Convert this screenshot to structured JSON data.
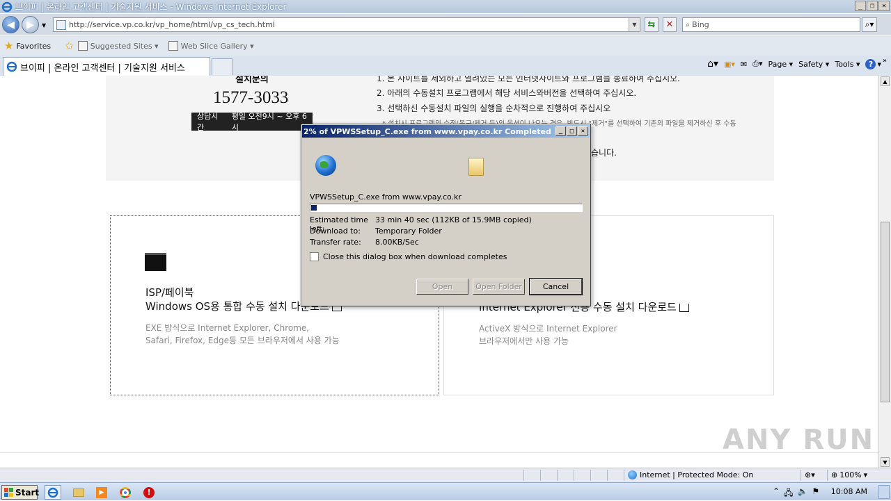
{
  "window": {
    "title": "브이피 | 온라인 고객센터 | 기술지원 서비스 - Windows Internet Explorer",
    "buttons": [
      "_",
      "❐",
      "✕"
    ]
  },
  "addressbar": {
    "url": "http://service.vp.co.kr/vp_home/html/vp_cs_tech.html",
    "search_placeholder": "Bing"
  },
  "favorites": {
    "favorites_label": "Favorites",
    "suggested_sites": "Suggested Sites ▾",
    "web_slice_gallery": "Web Slice Gallery ▾"
  },
  "tabs": {
    "active_tab": "브이피 | 온라인 고객센터 | 기술지원 서비스"
  },
  "commandbar": {
    "page": "Page ▾",
    "safety": "Safety ▾",
    "tools": "Tools ▾",
    "help": "?"
  },
  "webpage": {
    "inquiry_heading": "설치문의",
    "phone": "1577-3033",
    "hours_label": "상담시간",
    "hours_value": "평일 오전9시 ~ 오후 6시",
    "steps": [
      "1. 본 사이트를 제외하고 열려있는 모든 인터넷사이트와 프로그램을 종료하여 주십시오.",
      "2. 아래의 수동설치 프로그램에서 해당 서비스와버전을 선택하여 주십시오.",
      "3. 선택하신 수동설치 파일의 실행을 순차적으로 진행하여 주십시오"
    ],
    "note_line1": "* 설치시 프로그램의 수정(복구/제거 등)의 옵션이 나오는 경우, 반드시 \"제거\"를 선택하여 기존의 파일을 제거하신 후 수동",
    "note_line2": "습니다.",
    "card1": {
      "title1": "ISP/페이북",
      "title2": "Windows OS용 통합 수동 설치 다운로드",
      "desc1": "EXE 방식으로 Internet Explorer, Chrome,",
      "desc2": "Safari, Firefox, Edge등 모든 브라우저에서 사용 가능"
    },
    "card2": {
      "title2": "Internet Explorer 전용 수동 설치 다운로드",
      "desc1": "ActiveX 방식으로 Internet Explorer",
      "desc2": "브라우저에서만 사용 가능"
    }
  },
  "download_dialog": {
    "title": "2% of VPWSSetup_C.exe from www.vpay.co.kr Completed",
    "file_from": "VPWSSetup_C.exe from www.vpay.co.kr",
    "progress_fraction": 0.02,
    "estimated_label": "Estimated time left:",
    "estimated_value": "33 min 40 sec (112KB of 15.9MB copied)",
    "download_to_label": "Download to:",
    "download_to_value": "Temporary Folder",
    "transfer_label": "Transfer rate:",
    "transfer_value": "8.00KB/Sec",
    "close_checkbox": "Close this dialog box when download completes",
    "open_btn": "Open",
    "open_folder_btn": "Open Folder",
    "cancel_btn": "Cancel"
  },
  "statusbar": {
    "zone": "Internet | Protected Mode: On",
    "zoom": "100%"
  },
  "taskbar": {
    "start": "Start",
    "clock": "10:08 AM"
  },
  "watermark": "ANY RUN"
}
